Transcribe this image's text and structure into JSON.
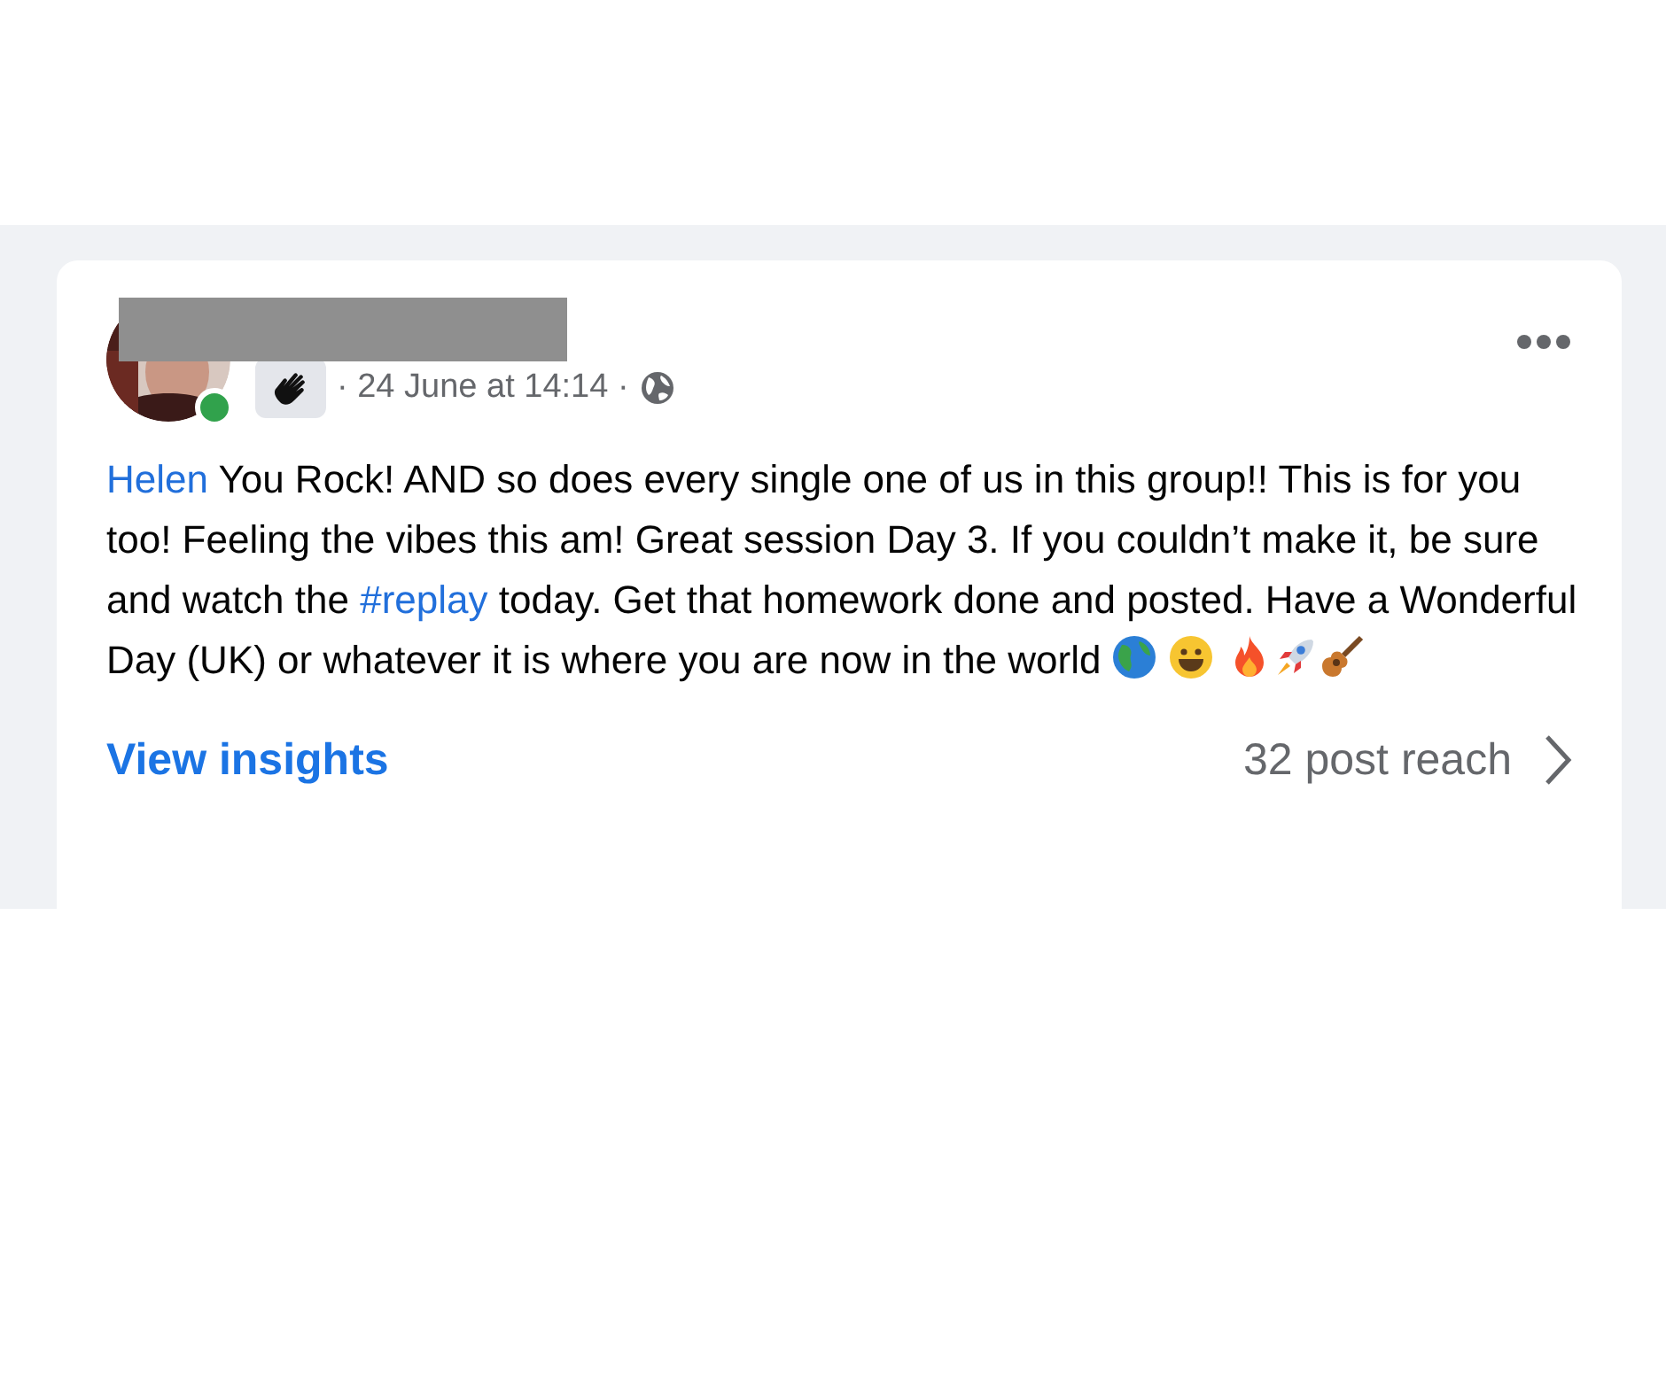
{
  "post": {
    "online": true,
    "timestamp": "· 24 June at 14:14 ·",
    "body": [
      {
        "kind": "link",
        "text": "Helen"
      },
      {
        "kind": "text",
        "text": " You Rock! AND so does every single one of us in this group!! This is for you too! Feeling the vibes this am! Great session Day 3. If you couldn’t make it, be sure and watch the "
      },
      {
        "kind": "link",
        "text": "#replay"
      },
      {
        "kind": "text",
        "text": " today. Get that homework done and posted. Have a Wonderful Day (UK) or whatever it is where you are now in the world "
      }
    ],
    "footer": {
      "link": "View insights",
      "reach": "32 post reach"
    }
  }
}
